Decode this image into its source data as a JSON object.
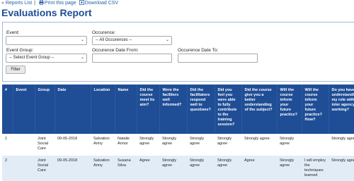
{
  "nav": {
    "reports_list": "« Reports List",
    "separator": "|",
    "print": "Print this page",
    "download": "Download CSV"
  },
  "page_title": "Evaluations Report",
  "filters": {
    "event_label": "Event:",
    "event_value": "",
    "occurence_label": "Occurence:",
    "occurence_value": "-- All Occurences --",
    "event_group_label": "Event Group:",
    "event_group_value": "-- Select Event Group --",
    "date_from_label": "Occurence Date From:",
    "date_from_value": "",
    "date_to_label": "Occurence Date To:",
    "date_to_value": "",
    "filter_button": "Filter"
  },
  "table": {
    "columns": [
      "#",
      "Event",
      "Group",
      "Date",
      "Location",
      "Name",
      "Did the course meet its aim?",
      "Were the faciliters well informed?",
      "Did the facilitators respond well to questions?",
      "Did you feel you were able to fully contribute to the training session?",
      "Did the course give you a better understanding of the subject?",
      "Will the course inform your future practice?",
      "Will the course inform your future practice? How?",
      "Do you have better understanding of my role within inter agency working?"
    ],
    "rows": [
      [
        "1",
        "",
        "Joint Social Care",
        "09-05-2018",
        "Salvation Army",
        "Natalie Annor",
        "Strongly agree",
        "Strongly agree",
        "Strongly agree",
        "Strongly agree",
        "Strongly agree",
        "Strongly agree",
        "",
        "Strongly agree"
      ],
      [
        "2",
        "",
        "Joint Social Care",
        "09-05-2018",
        "Salvation Army",
        "Susana Silva",
        "Agree",
        "Strongly agree",
        "Strongly agree",
        "Strongly agree",
        "Agree",
        "Strongly agree",
        "I will employ the techniques learned",
        "Strongly agree"
      ]
    ]
  },
  "colors": {
    "header_bg": "#1f4e96",
    "link": "#1f5ea8",
    "title": "#1f4e96",
    "alt_row": "#e2ecf7"
  }
}
